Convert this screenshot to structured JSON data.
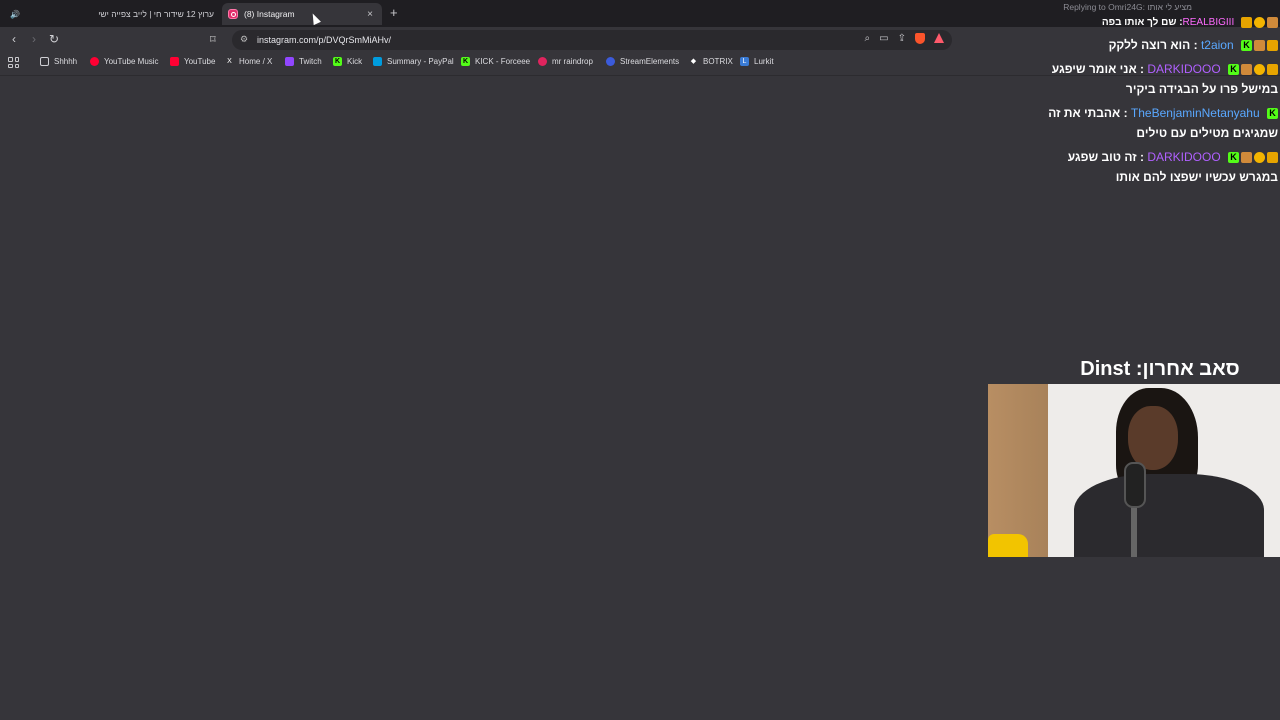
{
  "tabs": [
    {
      "title": "ערוץ 12 שידור חי | לייב צפייה ישי",
      "active": false
    },
    {
      "title": "(8) Instagram",
      "active": true
    }
  ],
  "newtab_label": "+",
  "close_label": "×",
  "url": "instagram.com/p/DVQrSmMiAHv/",
  "bookmarks": [
    {
      "label": "Shhhh",
      "icon": "folder-icon",
      "color": "#cfcfd4"
    },
    {
      "label": "YouTube Music",
      "icon": "youtube-music-icon",
      "color": "#ff0033"
    },
    {
      "label": "YouTube",
      "icon": "youtube-icon",
      "color": "#ff0033"
    },
    {
      "label": "Home / X",
      "icon": "x-icon",
      "color": "#ffffff"
    },
    {
      "label": "Twitch",
      "icon": "twitch-icon",
      "color": "#9146ff"
    },
    {
      "label": "Kick",
      "icon": "kick-icon",
      "color": "#53fc18"
    },
    {
      "label": "Summary - PayPal",
      "icon": "paypal-icon",
      "color": "#009cde"
    },
    {
      "label": "KICK - Forceee",
      "icon": "kick-icon",
      "color": "#53fc18"
    },
    {
      "label": "mr raindrop",
      "icon": "raindrop-icon",
      "color": "#e0245e"
    },
    {
      "label": "StreamElements",
      "icon": "streamelements-icon",
      "color": "#3b5bdb"
    },
    {
      "label": "BOTRIX",
      "icon": "botrix-icon",
      "color": "#ffffff"
    },
    {
      "label": "Lurkit",
      "icon": "lurkit-icon",
      "color": "#3a7bd5"
    }
  ],
  "chat": {
    "reply_to": "Replying to Omri24G: מציע לי אותו",
    "top_user": "REALBIGIII",
    "top_message": "שם לך אותו בפה",
    "messages": [
      {
        "user": "t2aion",
        "text": "הוא רוצה ללקק",
        "user_color": "#5aa8ff"
      },
      {
        "user": "DARKIDOOO",
        "text": "אני אומר שיפגע במישל פרו על הבגידה ביקיר",
        "user_color": "#b060ff"
      },
      {
        "user": "TheBenjaminNetanyahu",
        "text": "אהבתי את זה שמגיגים מטילים עם טילים",
        "user_color": "#5aa8ff"
      },
      {
        "user": "DARKIDOOO",
        "text": "זה טוב שפגע במגרש עכשיו ישפצו להם אותו",
        "user_color": "#b060ff"
      }
    ]
  },
  "overlay_title": "סאב אחרון: Dinst"
}
